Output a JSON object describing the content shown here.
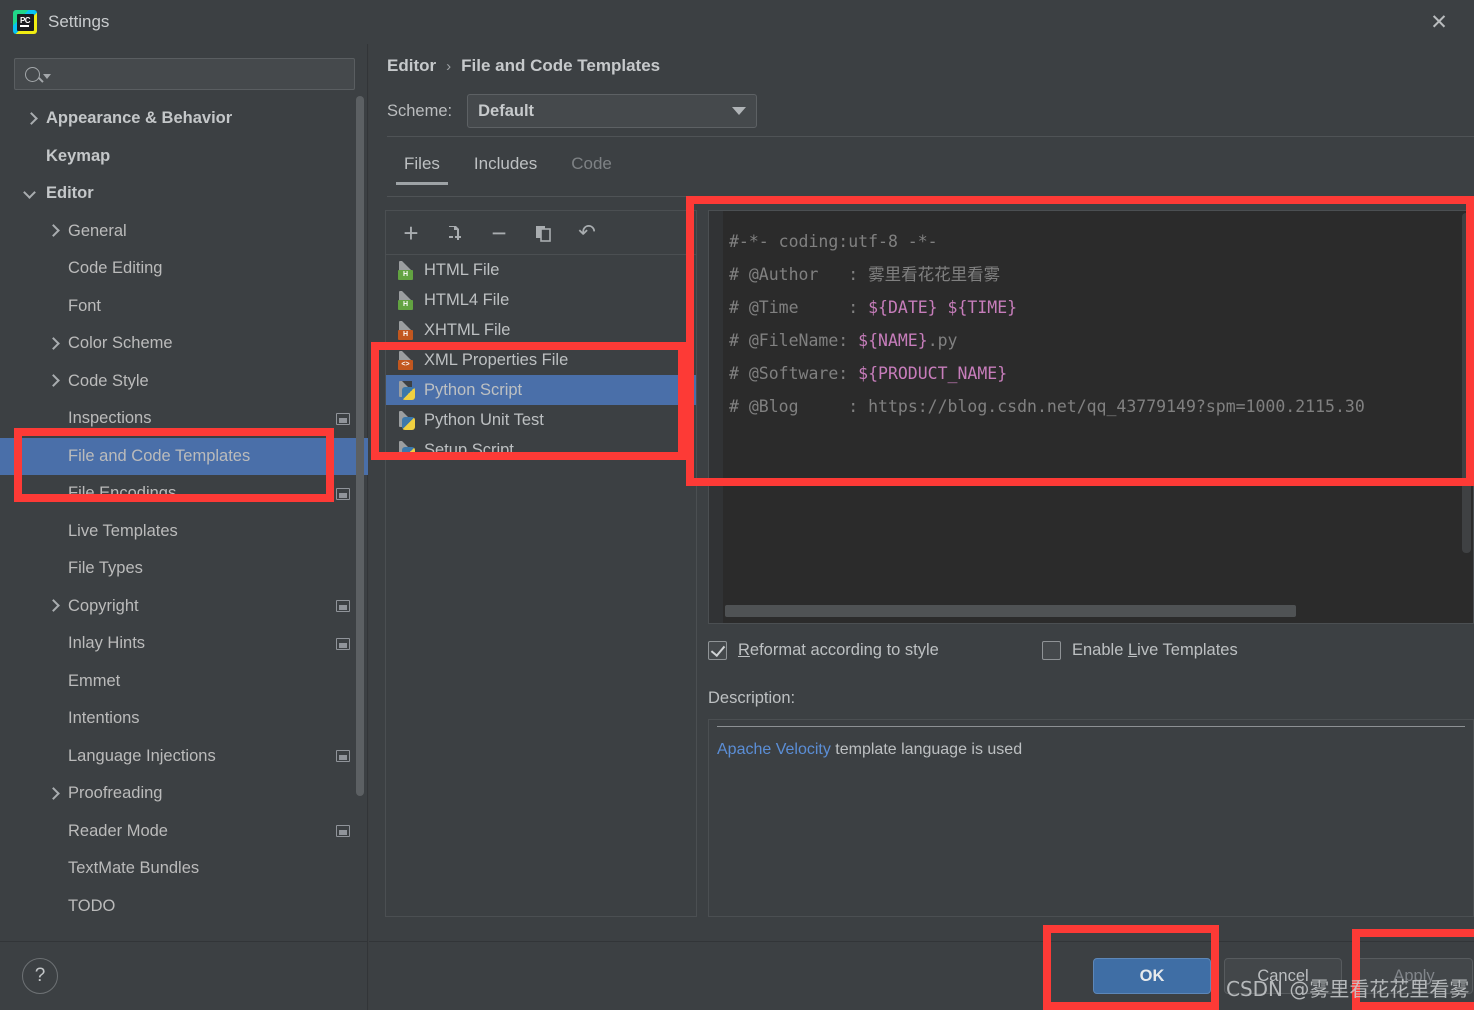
{
  "window": {
    "title": "Settings",
    "app_icon": "pycharm-icon",
    "close_icon": "✕"
  },
  "sidebar": {
    "search": {
      "placeholder": "",
      "value": ""
    },
    "items": [
      {
        "label": "Appearance & Behavior",
        "indent": 0,
        "arrow": "right",
        "bold": true,
        "badge": false,
        "selected": false
      },
      {
        "label": "Keymap",
        "indent": 0,
        "arrow": "none",
        "bold": true,
        "badge": false,
        "selected": false
      },
      {
        "label": "Editor",
        "indent": 0,
        "arrow": "down",
        "bold": true,
        "badge": false,
        "selected": false
      },
      {
        "label": "General",
        "indent": 1,
        "arrow": "right",
        "bold": false,
        "badge": false,
        "selected": false
      },
      {
        "label": "Code Editing",
        "indent": 1,
        "arrow": "none",
        "bold": false,
        "badge": false,
        "selected": false
      },
      {
        "label": "Font",
        "indent": 1,
        "arrow": "none",
        "bold": false,
        "badge": false,
        "selected": false
      },
      {
        "label": "Color Scheme",
        "indent": 1,
        "arrow": "right",
        "bold": false,
        "badge": false,
        "selected": false
      },
      {
        "label": "Code Style",
        "indent": 1,
        "arrow": "right",
        "bold": false,
        "badge": false,
        "selected": false
      },
      {
        "label": "Inspections",
        "indent": 1,
        "arrow": "none",
        "bold": false,
        "badge": true,
        "selected": false
      },
      {
        "label": "File and Code Templates",
        "indent": 1,
        "arrow": "none",
        "bold": false,
        "badge": false,
        "selected": true
      },
      {
        "label": "File Encodings",
        "indent": 1,
        "arrow": "none",
        "bold": false,
        "badge": true,
        "selected": false
      },
      {
        "label": "Live Templates",
        "indent": 1,
        "arrow": "none",
        "bold": false,
        "badge": false,
        "selected": false
      },
      {
        "label": "File Types",
        "indent": 1,
        "arrow": "none",
        "bold": false,
        "badge": false,
        "selected": false
      },
      {
        "label": "Copyright",
        "indent": 1,
        "arrow": "right",
        "bold": false,
        "badge": true,
        "selected": false
      },
      {
        "label": "Inlay Hints",
        "indent": 1,
        "arrow": "none",
        "bold": false,
        "badge": true,
        "selected": false
      },
      {
        "label": "Emmet",
        "indent": 1,
        "arrow": "none",
        "bold": false,
        "badge": false,
        "selected": false
      },
      {
        "label": "Intentions",
        "indent": 1,
        "arrow": "none",
        "bold": false,
        "badge": false,
        "selected": false
      },
      {
        "label": "Language Injections",
        "indent": 1,
        "arrow": "none",
        "bold": false,
        "badge": true,
        "selected": false
      },
      {
        "label": "Proofreading",
        "indent": 1,
        "arrow": "right",
        "bold": false,
        "badge": false,
        "selected": false
      },
      {
        "label": "Reader Mode",
        "indent": 1,
        "arrow": "none",
        "bold": false,
        "badge": true,
        "selected": false
      },
      {
        "label": "TextMate Bundles",
        "indent": 1,
        "arrow": "none",
        "bold": false,
        "badge": false,
        "selected": false
      },
      {
        "label": "TODO",
        "indent": 1,
        "arrow": "none",
        "bold": false,
        "badge": false,
        "selected": false
      }
    ],
    "help_label": "?"
  },
  "main": {
    "breadcrumb": {
      "parent": "Editor",
      "separator": "›",
      "current": "File and Code Templates"
    },
    "scheme": {
      "label": "Scheme:",
      "value": "Default"
    },
    "tabs": [
      {
        "label": "Files",
        "active": true,
        "disabled": false
      },
      {
        "label": "Includes",
        "active": false,
        "disabled": false
      },
      {
        "label": "Code",
        "active": false,
        "disabled": true
      }
    ],
    "file_toolbar": [
      {
        "name": "add-template-button",
        "glyph": "+"
      },
      {
        "name": "copy-template-button",
        "glyph": ""
      },
      {
        "name": "remove-template-button",
        "glyph": "−"
      },
      {
        "name": "duplicate-template-button",
        "glyph": ""
      },
      {
        "name": "reset-template-button",
        "glyph": "↶"
      }
    ],
    "files": [
      {
        "label": "HTML File",
        "icon": "html-file-icon",
        "tag": "H",
        "tag_color": "green",
        "selected": false
      },
      {
        "label": "HTML4 File",
        "icon": "html4-file-icon",
        "tag": "H",
        "tag_color": "green",
        "selected": false
      },
      {
        "label": "XHTML File",
        "icon": "xhtml-file-icon",
        "tag": "H",
        "tag_color": "orange",
        "selected": false
      },
      {
        "label": "XML Properties File",
        "icon": "xml-file-icon",
        "tag": "<>",
        "tag_color": "orange",
        "selected": false
      },
      {
        "label": "Python Script",
        "icon": "python-file-icon",
        "tag": "",
        "tag_color": "python",
        "selected": true
      },
      {
        "label": "Python Unit Test",
        "icon": "python-file-icon",
        "tag": "",
        "tag_color": "python",
        "selected": false
      },
      {
        "label": "Setup Script",
        "icon": "python-file-icon",
        "tag": "",
        "tag_color": "python",
        "selected": false
      }
    ],
    "template_code": {
      "line1_plain": "#-*- coding:utf-8 -*-",
      "line2_key": "# @Author   : ",
      "line2_value": "雾里看花花里看雾",
      "line3_key": "# @Time     : ",
      "line3_value": "${DATE} ${TIME}",
      "line4_key": "# @FileName: ",
      "line4_value": "${NAME}",
      "line4_suffix": ".py",
      "line5_key": "# @Software: ",
      "line5_value": "${PRODUCT_NAME}",
      "line6_key": "# @Blog     : ",
      "line6_value": "https://blog.csdn.net/qq_43779149?spm=1000.2115.30"
    },
    "checkboxes": [
      {
        "label": "Reformat according to style",
        "mnemonic": "R",
        "checked": true
      },
      {
        "label": "Enable Live Templates",
        "mnemonic": "L",
        "checked": false
      }
    ],
    "description": {
      "label": "Description:",
      "link_text": "Apache Velocity",
      "rest_text": " template language is used"
    }
  },
  "footer": {
    "ok": "OK",
    "cancel": "Cancel",
    "apply": "Apply"
  },
  "watermark": "CSDN @雾里看花花里看雾",
  "colors": {
    "window_bg": "#3c4043",
    "panel_bg": "#3c4043",
    "editor_bg": "#2b2b2b",
    "selection_blue": "#4a6fa9",
    "accent_button": "#3f6ea5",
    "annotation_red": "#fd3a36",
    "link_blue": "#5b8ed6",
    "template_var": "#c77dbb",
    "text_primary": "#bdc0c2"
  }
}
